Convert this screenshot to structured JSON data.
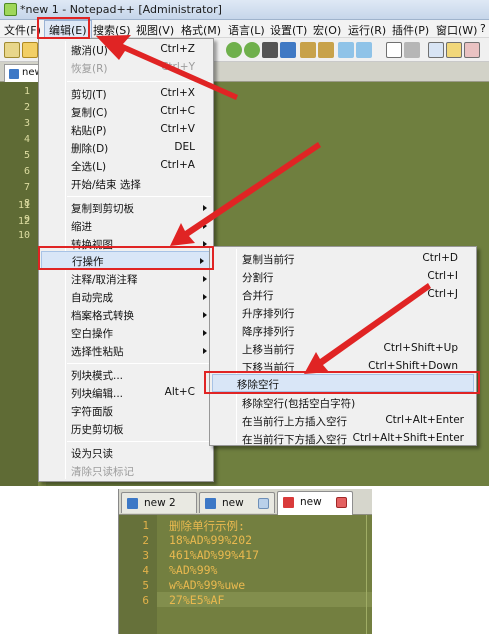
{
  "window": {
    "title": "*new 1 - Notepad++ [Administrator]"
  },
  "menubar": {
    "items": [
      "文件(F)",
      "编辑(E)",
      "搜索(S)",
      "视图(V)",
      "格式(M)",
      "语言(L)",
      "设置(T)",
      "宏(O)",
      "运行(R)",
      "插件(P)",
      "窗口(W)",
      "?"
    ]
  },
  "top_tab": {
    "label": "new"
  },
  "top_line_numbers": [
    "1",
    "2",
    "3",
    "4",
    "5",
    "6",
    "7",
    "8",
    "9",
    "10",
    "11",
    "12"
  ],
  "edit_menu": {
    "items": [
      {
        "label": "撤消(U)",
        "shortcut": "Ctrl+Z"
      },
      {
        "label": "恢复(R)",
        "shortcut": "Ctrl+Y"
      },
      {
        "label": "剪切(T)",
        "shortcut": "Ctrl+X"
      },
      {
        "label": "复制(C)",
        "shortcut": "Ctrl+C"
      },
      {
        "label": "粘贴(P)",
        "shortcut": "Ctrl+V"
      },
      {
        "label": "删除(D)",
        "shortcut": "DEL"
      },
      {
        "label": "全选(L)",
        "shortcut": "Ctrl+A"
      },
      {
        "label": "开始/结束 选择",
        "shortcut": ""
      },
      {
        "label": "复制到剪切板",
        "shortcut": ""
      },
      {
        "label": "缩进",
        "shortcut": ""
      },
      {
        "label": "转换视图",
        "shortcut": ""
      },
      {
        "label": "行操作",
        "shortcut": ""
      },
      {
        "label": "注释/取消注释",
        "shortcut": ""
      },
      {
        "label": "自动完成",
        "shortcut": ""
      },
      {
        "label": "档案格式转换",
        "shortcut": ""
      },
      {
        "label": "空白操作",
        "shortcut": ""
      },
      {
        "label": "选择性粘贴",
        "shortcut": ""
      },
      {
        "label": "列块模式...",
        "shortcut": ""
      },
      {
        "label": "列块编辑...",
        "shortcut": "Alt+C"
      },
      {
        "label": "字符面版",
        "shortcut": ""
      },
      {
        "label": "历史剪切板",
        "shortcut": ""
      },
      {
        "label": "设为只读",
        "shortcut": ""
      },
      {
        "label": "清除只读标记",
        "shortcut": ""
      }
    ]
  },
  "line_ops_menu": {
    "items": [
      {
        "label": "复制当前行",
        "shortcut": "Ctrl+D"
      },
      {
        "label": "分割行",
        "shortcut": "Ctrl+I"
      },
      {
        "label": "合并行",
        "shortcut": "Ctrl+J"
      },
      {
        "label": "升序排列行",
        "shortcut": ""
      },
      {
        "label": "降序排列行",
        "shortcut": ""
      },
      {
        "label": "上移当前行",
        "shortcut": "Ctrl+Shift+Up"
      },
      {
        "label": "下移当前行",
        "shortcut": "Ctrl+Shift+Down"
      },
      {
        "label": "移除空行",
        "shortcut": ""
      },
      {
        "label": "移除空行(包括空白字符)",
        "shortcut": ""
      },
      {
        "label": "在当前行上方插入空行",
        "shortcut": "Ctrl+Alt+Enter"
      },
      {
        "label": "在当前行下方插入空行",
        "shortcut": "Ctrl+Alt+Shift+Enter"
      }
    ]
  },
  "bottom_tabs": [
    {
      "label": "new 2"
    },
    {
      "label": "new"
    },
    {
      "label": "new"
    }
  ],
  "bottom_editor": {
    "line_numbers": [
      "1",
      "2",
      "3",
      "4",
      "5",
      "6"
    ],
    "lines": [
      "删除单行示例:",
      "18%AD%99%202",
      "461%AD%99%417",
      "%AD%99%",
      "w%AD%99%uwe",
      "27%E5%AF"
    ]
  },
  "colors": {
    "highlight_box": "#e02424",
    "arrow": "#e02424",
    "editor_bg": "#6f7f3f",
    "code_text": "#e9b94f"
  }
}
